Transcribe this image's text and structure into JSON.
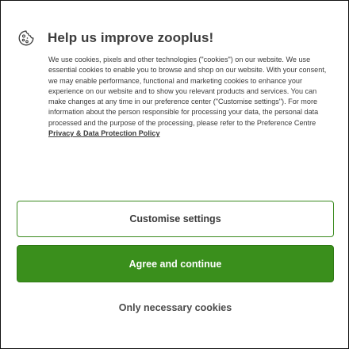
{
  "dialog": {
    "title": "Help us improve zooplus!",
    "icon": "cookie-icon",
    "body_text": "We use cookies, pixels and other technologies (\"cookies\") on our website. We use essential cookies to enable you to browse and shop on our website. With your consent, we may enable performance, functional and marketing cookies to enhance your experience on our website and to show you relevant products and services. You can make changes at any time in our preference center (\"Customise settings\"). For more information about the person responsible for processing your data, the personal data processed and the purpose of the processing, please refer to the Preference Centre ",
    "policy_link": "Privacy & Data Protection Policy"
  },
  "buttons": {
    "customise": "Customise settings",
    "agree": "Agree and continue",
    "necessary": "Only necessary cookies"
  },
  "colors": {
    "accent": "#3a8f1c",
    "text": "#3a3a3a"
  }
}
